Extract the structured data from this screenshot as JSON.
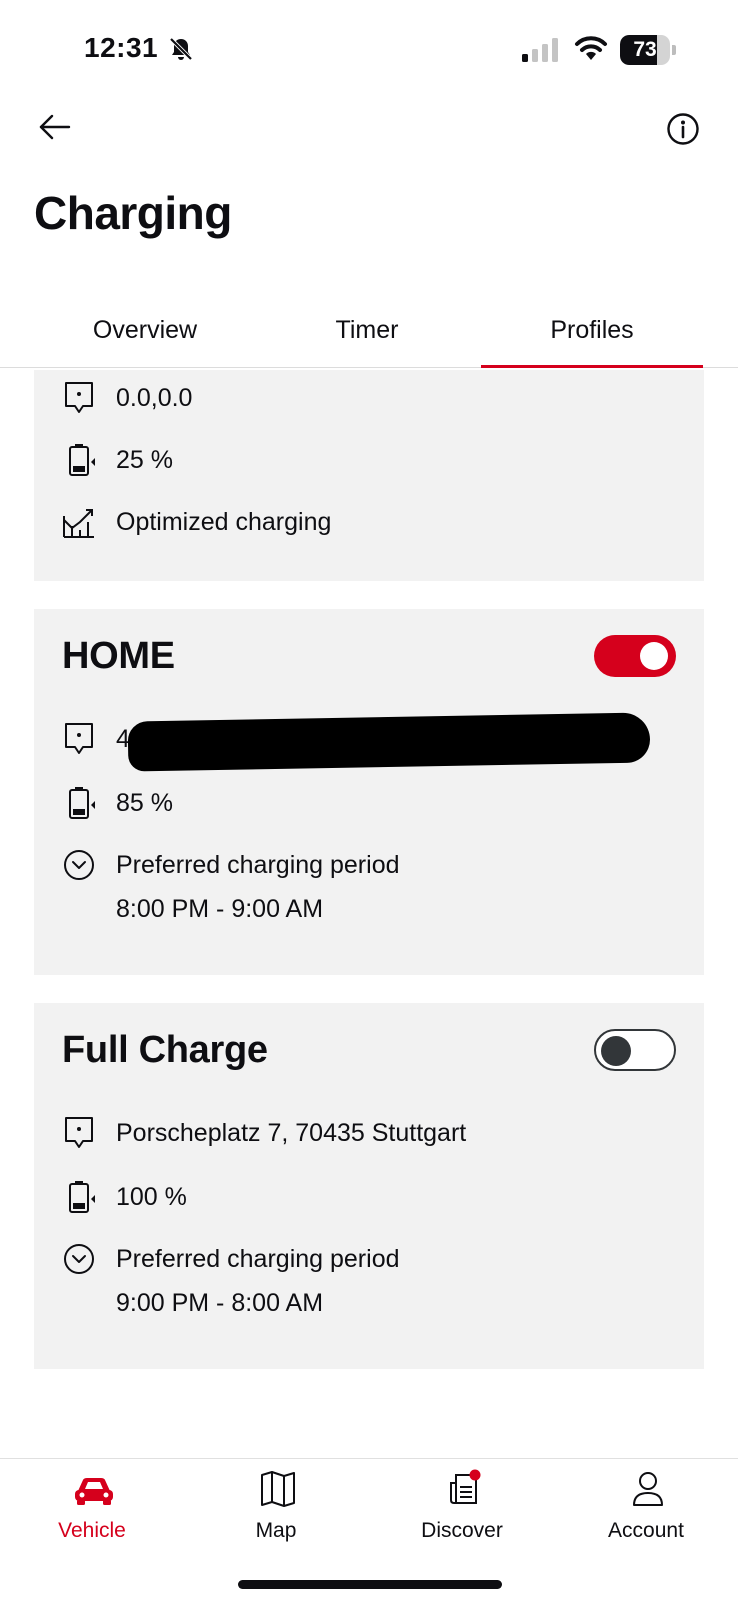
{
  "status_bar": {
    "time": "12:31",
    "battery": "73",
    "battery_percent": 73
  },
  "header": {
    "title": "Charging"
  },
  "tabs": [
    {
      "label": "Overview",
      "active": false
    },
    {
      "label": "Timer",
      "active": false
    },
    {
      "label": "Profiles",
      "active": true
    }
  ],
  "profiles": [
    {
      "location": "0.0,0.0",
      "target_charge": "25 %",
      "mode": "Optimized charging"
    },
    {
      "name": "HOME",
      "enabled": true,
      "location": "4",
      "target_charge": "85 %",
      "period_label": "Preferred charging period",
      "period": "8:00 PM - 9:00 AM"
    },
    {
      "name": "Full Charge",
      "enabled": false,
      "location": "Porscheplatz 7, 70435 Stuttgart",
      "target_charge": "100 %",
      "period_label": "Preferred charging period",
      "period": "9:00 PM - 8:00 AM"
    }
  ],
  "bottom_nav": [
    {
      "label": "Vehicle",
      "icon": "car-icon",
      "active": true
    },
    {
      "label": "Map",
      "icon": "map-icon",
      "active": false
    },
    {
      "label": "Discover",
      "icon": "discover-icon",
      "active": false
    },
    {
      "label": "Account",
      "icon": "account-icon",
      "active": false
    }
  ],
  "colors": {
    "accent": "#d5001c",
    "card_background": "#f2f2f2",
    "text": "#0e0e12"
  }
}
